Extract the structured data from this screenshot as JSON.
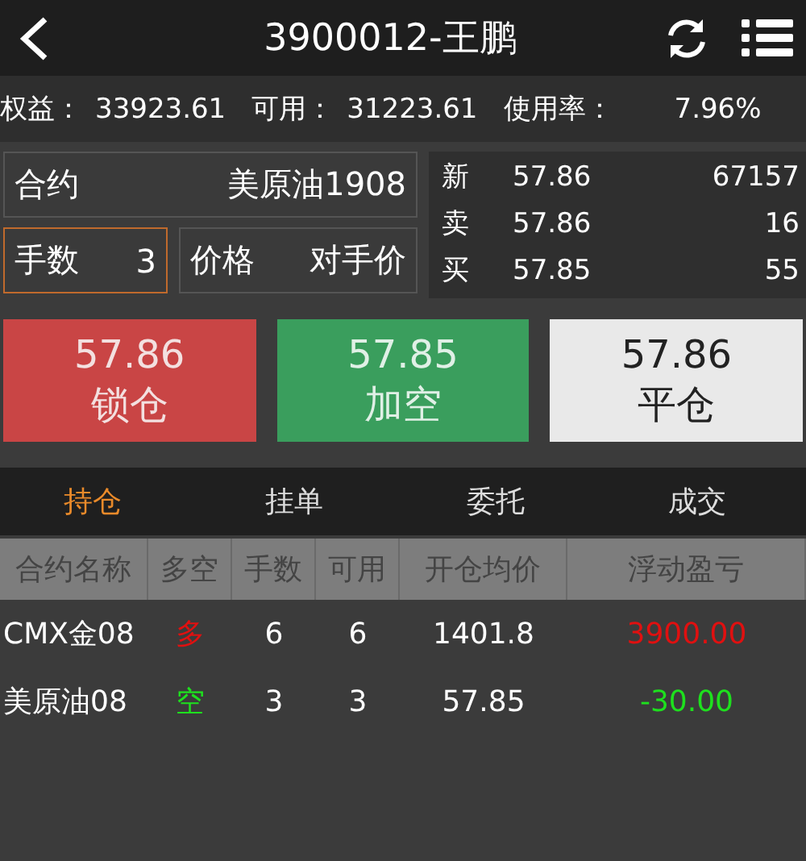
{
  "header": {
    "title": "3900012-王鹏"
  },
  "account": [
    {
      "label": "权益：",
      "value": "33923.61"
    },
    {
      "label": "可用：",
      "value": "31223.61"
    },
    {
      "label": "使用率：",
      "value": "7.96%"
    }
  ],
  "order": {
    "contract": {
      "label": "合约",
      "value": "美原油1908",
      "focused": false
    },
    "lots": {
      "label": "手数",
      "value": "3",
      "focused": true
    },
    "price": {
      "label": "价格",
      "value": "对手价",
      "focused": false
    }
  },
  "quotes": [
    {
      "label": "新",
      "price": "57.86",
      "volume": "67157"
    },
    {
      "label": "卖",
      "price": "57.86",
      "volume": "16"
    },
    {
      "label": "买",
      "price": "57.85",
      "volume": "55"
    }
  ],
  "actions": [
    {
      "kind": "lock",
      "price": "57.86",
      "label": "锁仓"
    },
    {
      "kind": "short",
      "price": "57.85",
      "label": "加空"
    },
    {
      "kind": "close",
      "price": "57.86",
      "label": "平仓"
    }
  ],
  "tabs": [
    {
      "label": "持仓",
      "selected": true
    },
    {
      "label": "挂单",
      "selected": false
    },
    {
      "label": "委托",
      "selected": false
    },
    {
      "label": "成交",
      "selected": false
    }
  ],
  "table": {
    "columns": [
      "合约名称",
      "多空",
      "手数",
      "可用",
      "开仓均价",
      "浮动盈亏"
    ],
    "rows": [
      {
        "name": "CMX金08",
        "long": true,
        "direction": "多",
        "lots": "6",
        "available": "6",
        "avg_price": "1401.8",
        "pnl": "3900.00",
        "profit": true
      },
      {
        "name": "美原油08",
        "long": false,
        "direction": "空",
        "lots": "3",
        "available": "3",
        "avg_price": "57.85",
        "pnl": "-30.00",
        "profit": false
      }
    ]
  }
}
